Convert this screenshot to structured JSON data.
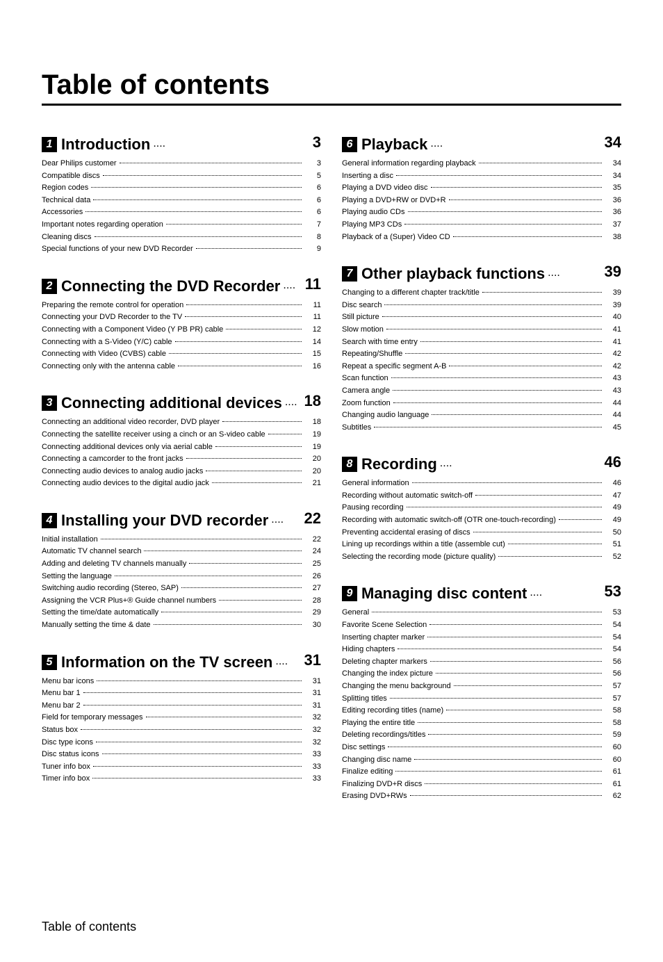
{
  "page_title": "Table of contents",
  "footer": "Table of contents",
  "sections": [
    {
      "num": "1",
      "title": "Introduction",
      "page": "3",
      "entries": [
        {
          "label": "Dear Philips customer",
          "page": "3"
        },
        {
          "label": "Compatible discs",
          "page": "5"
        },
        {
          "label": "Region codes",
          "page": "6"
        },
        {
          "label": "Technical data",
          "page": "6"
        },
        {
          "label": "Accessories",
          "page": "6"
        },
        {
          "label": "Important notes regarding operation",
          "page": "7"
        },
        {
          "label": "Cleaning discs",
          "page": "8"
        },
        {
          "label": "Special functions of your new DVD Recorder",
          "page": "9"
        }
      ]
    },
    {
      "num": "2",
      "title": "Connecting the DVD Recorder",
      "page": "11",
      "entries": [
        {
          "label": "Preparing the remote control for operation",
          "page": "11"
        },
        {
          "label": "Connecting your DVD Recorder to the TV",
          "page": "11"
        },
        {
          "label": "Connecting with a Component Video (Y PB PR) cable",
          "page": "12"
        },
        {
          "label": "Connecting with a S-Video (Y/C) cable",
          "page": "14"
        },
        {
          "label": "Connecting with Video (CVBS) cable",
          "page": "15"
        },
        {
          "label": "Connecting only with the antenna cable",
          "page": "16"
        }
      ]
    },
    {
      "num": "3",
      "title": "Connecting additional devices",
      "page": "18",
      "entries": [
        {
          "label": "Connecting an additional video recorder, DVD player",
          "page": "18"
        },
        {
          "label": "Connecting the satellite receiver using a cinch or an S-video cable",
          "page": "19"
        },
        {
          "label": "Connecting additional devices only via aerial cable",
          "page": "19"
        },
        {
          "label": "Connecting a camcorder to the front jacks",
          "page": "20"
        },
        {
          "label": "Connecting audio devices to analog audio jacks",
          "page": "20"
        },
        {
          "label": "Connecting audio devices to the digital audio jack",
          "page": "21"
        }
      ]
    },
    {
      "num": "4",
      "title": "Installing your DVD recorder",
      "page": "22",
      "entries": [
        {
          "label": "Initial installation",
          "page": "22"
        },
        {
          "label": "Automatic TV channel search",
          "page": "24"
        },
        {
          "label": "Adding and deleting TV channels manually",
          "page": "25"
        },
        {
          "label": "Setting the language",
          "page": "26"
        },
        {
          "label": "Switching audio recording (Stereo, SAP)",
          "page": "27"
        },
        {
          "label": "Assigning the VCR Plus+® Guide channel numbers",
          "page": "28"
        },
        {
          "label": "Setting the time/date automatically",
          "page": "29"
        },
        {
          "label": "Manually setting the time & date",
          "page": "30"
        }
      ]
    },
    {
      "num": "5",
      "title": "Information on the TV screen",
      "page": "31",
      "entries": [
        {
          "label": "Menu bar icons",
          "page": "31"
        },
        {
          "label": "Menu bar 1",
          "page": "31"
        },
        {
          "label": "Menu bar 2",
          "page": "31"
        },
        {
          "label": "Field for temporary messages",
          "page": "32"
        },
        {
          "label": "Status box",
          "page": "32"
        },
        {
          "label": "Disc type icons",
          "page": "32"
        },
        {
          "label": "Disc status icons",
          "page": "33"
        },
        {
          "label": "Tuner info box",
          "page": "33"
        },
        {
          "label": "Timer info box",
          "page": "33"
        }
      ]
    },
    {
      "num": "6",
      "title": "Playback",
      "page": "34",
      "entries": [
        {
          "label": "General information regarding playback",
          "page": "34"
        },
        {
          "label": "Inserting a disc",
          "page": "34"
        },
        {
          "label": "Playing a DVD video disc",
          "page": "35"
        },
        {
          "label": "Playing a DVD+RW or DVD+R",
          "page": "36"
        },
        {
          "label": "Playing audio CDs",
          "page": "36"
        },
        {
          "label": "Playing MP3 CDs",
          "page": "37"
        },
        {
          "label": "Playback of a (Super) Video CD",
          "page": "38"
        }
      ]
    },
    {
      "num": "7",
      "title": "Other playback functions",
      "page": "39",
      "entries": [
        {
          "label": "Changing to a different chapter track/title",
          "page": "39"
        },
        {
          "label": "Disc search",
          "page": "39"
        },
        {
          "label": "Still picture",
          "page": "40"
        },
        {
          "label": "Slow motion",
          "page": "41"
        },
        {
          "label": "Search with time entry",
          "page": "41"
        },
        {
          "label": "Repeating/Shuffle",
          "page": "42"
        },
        {
          "label": "Repeat a specific segment A-B",
          "page": "42"
        },
        {
          "label": "Scan function",
          "page": "43"
        },
        {
          "label": "Camera angle",
          "page": "43"
        },
        {
          "label": "Zoom function",
          "page": "44"
        },
        {
          "label": "Changing audio language",
          "page": "44"
        },
        {
          "label": "Subtitles",
          "page": "45"
        }
      ]
    },
    {
      "num": "8",
      "title": "Recording",
      "page": "46",
      "entries": [
        {
          "label": "General information",
          "page": "46"
        },
        {
          "label": "Recording without automatic switch-off",
          "page": "47"
        },
        {
          "label": "Pausing recording",
          "page": "49"
        },
        {
          "label": "Recording with automatic switch-off (OTR one-touch-recording)",
          "page": "49"
        },
        {
          "label": "Preventing accidental erasing of discs",
          "page": "50"
        },
        {
          "label": "Lining up recordings within a title (assemble cut)",
          "page": "51"
        },
        {
          "label": "Selecting the recording mode (picture quality)",
          "page": "52"
        }
      ]
    },
    {
      "num": "9",
      "title": "Managing disc content",
      "page": "53",
      "entries": [
        {
          "label": "General",
          "page": "53"
        },
        {
          "label": "Favorite Scene Selection",
          "page": "54"
        },
        {
          "label": "Inserting chapter marker",
          "page": "54"
        },
        {
          "label": "Hiding chapters",
          "page": "54"
        },
        {
          "label": "Deleting chapter markers",
          "page": "56"
        },
        {
          "label": "Changing the index picture",
          "page": "56"
        },
        {
          "label": "Changing the menu background",
          "page": "57"
        },
        {
          "label": "Splitting titles",
          "page": "57"
        },
        {
          "label": "Editing recording titles (name)",
          "page": "58"
        },
        {
          "label": "Playing the entire title",
          "page": "58"
        },
        {
          "label": "Deleting recordings/titles",
          "page": "59"
        },
        {
          "label": "Disc settings",
          "page": "60"
        },
        {
          "label": "Changing disc name",
          "page": "60"
        },
        {
          "label": "Finalize editing",
          "page": "61"
        },
        {
          "label": "Finalizing DVD+R discs",
          "page": "61"
        },
        {
          "label": "Erasing DVD+RWs",
          "page": "62"
        }
      ]
    }
  ]
}
